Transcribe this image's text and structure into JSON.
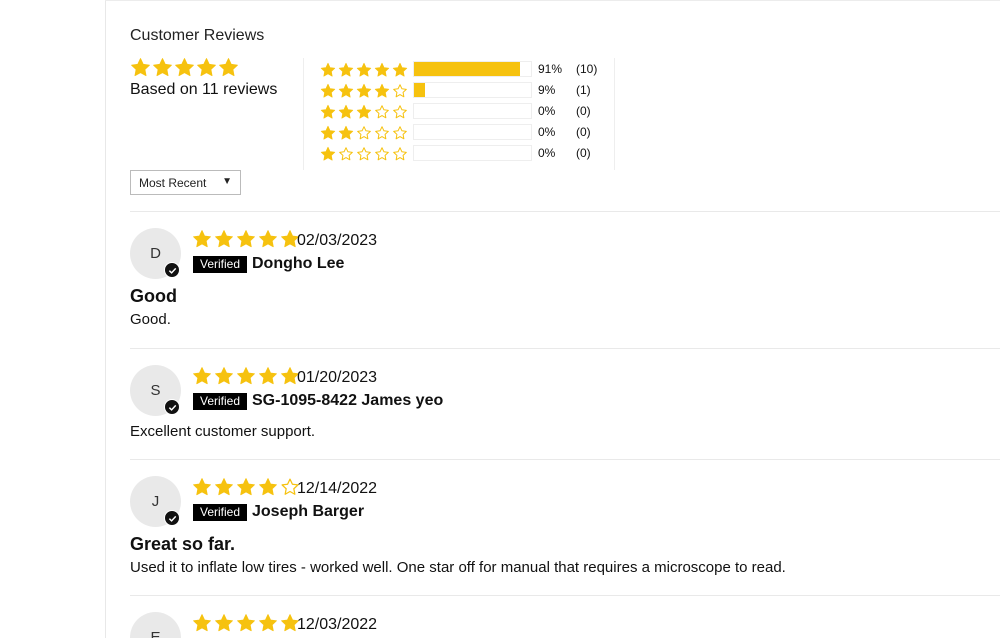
{
  "colors": {
    "star": "#f6c20f",
    "verified_bg": "#000000"
  },
  "header": {
    "title": "Customer Reviews"
  },
  "summary": {
    "average_stars": 5,
    "based_on": "Based on 11 reviews"
  },
  "histogram": [
    {
      "stars": 5,
      "percent_value": 91,
      "percent": "91%",
      "count": "(10)"
    },
    {
      "stars": 4,
      "percent_value": 9,
      "percent": "9%",
      "count": "(1)"
    },
    {
      "stars": 3,
      "percent_value": 0,
      "percent": "0%",
      "count": "(0)"
    },
    {
      "stars": 2,
      "percent_value": 0,
      "percent": "0%",
      "count": "(0)"
    },
    {
      "stars": 1,
      "percent_value": 0,
      "percent": "0%",
      "count": "(0)"
    }
  ],
  "sort": {
    "selected": "Most Recent",
    "caret_icon": "caret-down-icon"
  },
  "reviews": [
    {
      "initial": "D",
      "rating": 5,
      "date": "02/03/2023",
      "badge": "Verified",
      "author": "Dongho Lee",
      "title": "Good",
      "body": "Good."
    },
    {
      "initial": "S",
      "rating": 5,
      "date": "01/20/2023",
      "badge": "Verified",
      "author": "SG-1095-8422 James yeo",
      "title": "",
      "body": "Excellent customer support."
    },
    {
      "initial": "J",
      "rating": 4,
      "date": "12/14/2022",
      "badge": "Verified",
      "author": "Joseph Barger",
      "title": "Great so far.",
      "body": "Used it to inflate low tires - worked well. One star off for manual that requires a microscope to read."
    },
    {
      "initial": "E",
      "rating": 5,
      "date": "12/03/2022",
      "badge": "",
      "author": "",
      "title": "",
      "body": ""
    }
  ]
}
